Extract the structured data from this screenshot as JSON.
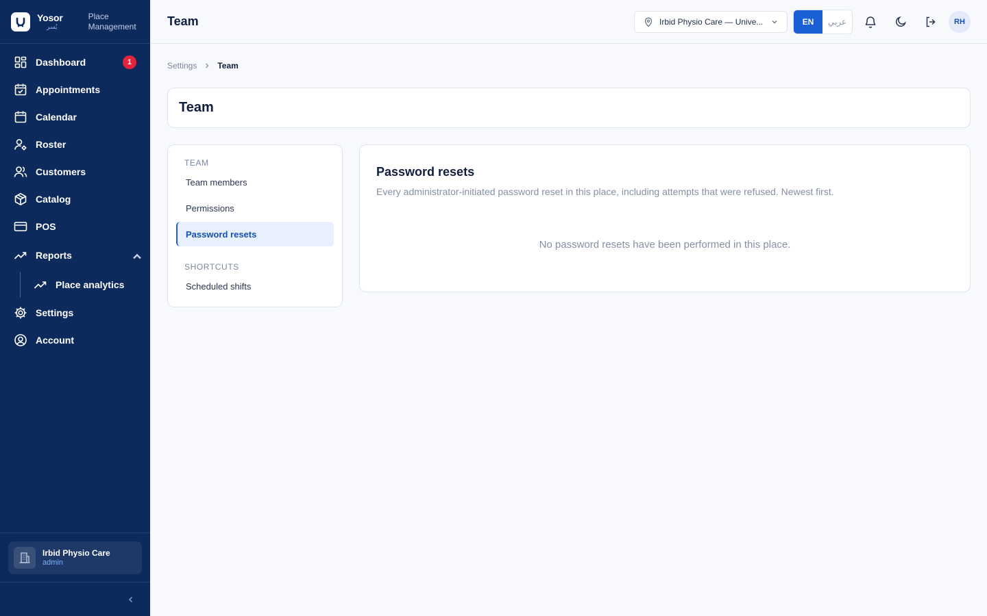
{
  "app": {
    "brand_name": "Yosor",
    "brand_name_ar": "يُسر",
    "brand_subtitle": "Place Management"
  },
  "sidebar": {
    "items": [
      {
        "label": "Dashboard",
        "icon": "dashboard-icon",
        "badge": "1"
      },
      {
        "label": "Appointments",
        "icon": "calendar-check-icon"
      },
      {
        "label": "Calendar",
        "icon": "calendar-icon"
      },
      {
        "label": "Roster",
        "icon": "user-gear-icon"
      },
      {
        "label": "Customers",
        "icon": "users-icon"
      },
      {
        "label": "Catalog",
        "icon": "package-icon"
      },
      {
        "label": "POS",
        "icon": "credit-card-icon"
      },
      {
        "label": "Reports",
        "icon": "trending-up-icon",
        "expanded": true
      },
      {
        "label": "Settings",
        "icon": "gear-icon"
      },
      {
        "label": "Account",
        "icon": "user-circle-icon"
      }
    ],
    "sub_items": [
      {
        "label": "Place analytics",
        "icon": "trending-up-icon"
      }
    ],
    "place_card": {
      "name": "Irbid Physio Care",
      "role": "admin"
    }
  },
  "topbar": {
    "title": "Team",
    "place_selector": "Irbid Physio Care — Unive...",
    "lang_en": "EN",
    "lang_ar": "عربي",
    "avatar_initials": "RH"
  },
  "breadcrumb": {
    "parent": "Settings",
    "current": "Team"
  },
  "page": {
    "title": "Team"
  },
  "settings_nav": {
    "section_team": "Team",
    "team_items": [
      "Team members",
      "Permissions",
      "Password resets"
    ],
    "active_item": "Password resets",
    "section_shortcuts": "Shortcuts",
    "shortcut_items": [
      "Scheduled shifts"
    ]
  },
  "content": {
    "title": "Password resets",
    "description": "Every administrator-initiated password reset in this place, including attempts that were refused. Newest first.",
    "empty_message": "No password resets have been performed in this place."
  },
  "colors": {
    "sidebar_bg": "#0d2a5c",
    "accent": "#1a5fd6",
    "badge": "#e5243b",
    "page_bg": "#f7f9fc"
  }
}
